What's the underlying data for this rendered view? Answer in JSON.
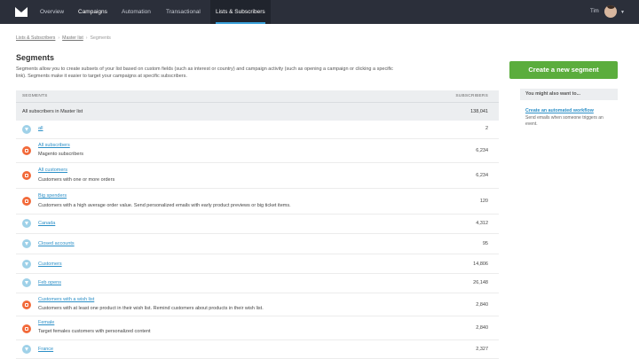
{
  "nav": {
    "items": [
      "Overview",
      "Campaigns",
      "Automation",
      "Transactional",
      "Lists & Subscribers"
    ],
    "active": "Lists & Subscribers",
    "user_name": "Tim"
  },
  "breadcrumb": [
    "Lists & Subscribers",
    "Master list",
    "Segments"
  ],
  "page": {
    "title": "Segments",
    "intro": "Segments allow you to create subsets of your list based on custom fields (such as interest or country) and campaign activity (such as opening a campaign or clicking a specific link). Segments make it easier to target your campaigns at specific subscribers."
  },
  "table": {
    "col_segments": "SEGMENTS",
    "col_subscribers": "SUBSCRIBERS",
    "all_row": {
      "label": "All subscribers in Master list",
      "count": "138,041"
    },
    "rows": [
      {
        "icon": "filter",
        "name": "all",
        "desc": "",
        "count": "2"
      },
      {
        "icon": "automation",
        "name": "All subscribers",
        "desc": "Magento subscribers",
        "count": "6,234"
      },
      {
        "icon": "automation",
        "name": "All customers",
        "desc": "Customers with one or more orders",
        "count": "6,234"
      },
      {
        "icon": "automation",
        "name": "Big spenders",
        "desc": "Customers with a high average order value. Send personalized emails with early product previews or big ticket items.",
        "count": "120"
      },
      {
        "icon": "filter",
        "name": "Canada",
        "desc": "",
        "count": "4,312"
      },
      {
        "icon": "filter",
        "name": "Closed accounts",
        "desc": "",
        "count": "95"
      },
      {
        "icon": "filter",
        "name": "Customers",
        "desc": "",
        "count": "14,806"
      },
      {
        "icon": "filter",
        "name": "Feb opens",
        "desc": "",
        "count": "26,148"
      },
      {
        "icon": "automation",
        "name": "Customers with a wish list",
        "desc": "Customers with at least one product in their wish list. Remind customers about products in their wish list.",
        "count": "2,840"
      },
      {
        "icon": "automation",
        "name": "Female",
        "desc": "Target females customers with personalized content",
        "count": "2,840"
      },
      {
        "icon": "filter",
        "name": "France",
        "desc": "",
        "count": "2,327"
      }
    ]
  },
  "sidebar": {
    "create_button": "Create a new segment",
    "box_title": "You might also want to...",
    "link": "Create an automated workflow",
    "link_desc": "Send emails when someone triggers an event."
  },
  "colors": {
    "nav_bg": "#2b2f3a",
    "accent": "#3aa0d9",
    "button": "#5bad3d",
    "automation_icon": "#f26a3a",
    "filter_icon": "#9fd1e8"
  }
}
